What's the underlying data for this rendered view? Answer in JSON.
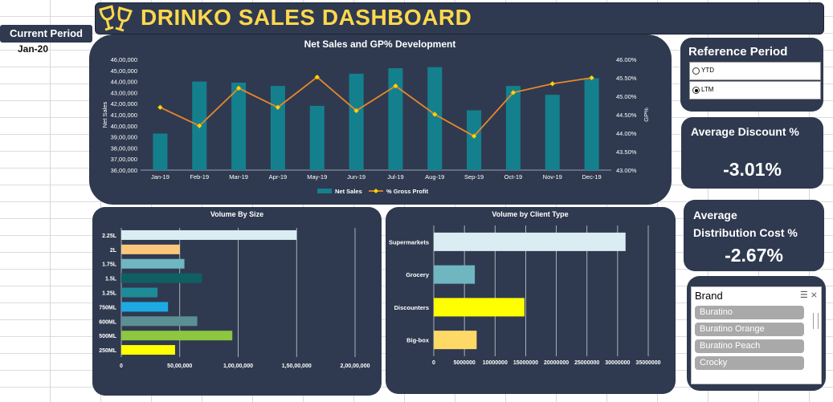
{
  "header": {
    "title": "DRINKO SALES DASHBOARD"
  },
  "current_period": {
    "label": "Current Period",
    "value": "Jan-20"
  },
  "reference_period": {
    "title": "Reference Period",
    "options": [
      {
        "label": "YTD",
        "selected": false
      },
      {
        "label": "LTM",
        "selected": true
      }
    ]
  },
  "kpis": {
    "discount": {
      "title": "Average Discount %",
      "value": "-3.01%"
    },
    "distribution": {
      "title_line1": "Average",
      "title_line2": "Distribution Cost %",
      "value": "-2.67%"
    }
  },
  "brand_slicer": {
    "title": "Brand",
    "items": [
      "Buratino",
      "Buratino Orange",
      "Buratino Peach",
      "Crocky"
    ]
  },
  "colors": {
    "panel": "#2f3a50",
    "bar": "#14808e",
    "line": "#e8872a",
    "marker": "#ffd700",
    "title": "#ffd84d"
  },
  "chart_data": [
    {
      "type": "bar+line",
      "title": "Net Sales and GP% Development",
      "categories": [
        "Jan-19",
        "Feb-19",
        "Mar-19",
        "Apr-19",
        "May-19",
        "Jun-19",
        "Jul-19",
        "Aug-19",
        "Sep-19",
        "Oct-19",
        "Nov-19",
        "Dec-19"
      ],
      "series": [
        {
          "name": "Net Sales",
          "type": "bar",
          "axis": "left",
          "values": [
            39300000,
            44000000,
            43900000,
            43600000,
            41800000,
            44700000,
            45200000,
            45300000,
            41400000,
            43600000,
            42800000,
            44300000
          ]
        },
        {
          "name": "% Gross Profit",
          "type": "line",
          "axis": "right",
          "values": [
            0.447,
            0.442,
            0.4522,
            0.447,
            0.4552,
            0.4461,
            0.4528,
            0.4451,
            0.4392,
            0.451,
            0.4534,
            0.455
          ]
        }
      ],
      "ylabel": "Net Sales",
      "y2label": "GP%",
      "ylim": [
        36000000,
        46000000
      ],
      "y2lim": [
        0.43,
        0.46
      ],
      "yticks": [
        "36,00,000",
        "37,00,000",
        "38,00,000",
        "39,00,000",
        "40,00,000",
        "41,00,000",
        "42,00,000",
        "43,00,000",
        "44,00,000",
        "45,00,000",
        "46,00,000"
      ],
      "y2ticks": [
        "43.00%",
        "43.50%",
        "44.00%",
        "44.50%",
        "45.00%",
        "45.50%",
        "46.00%"
      ],
      "legend": "bottom"
    },
    {
      "type": "bar",
      "orientation": "horizontal",
      "title": "Volume By Size",
      "categories": [
        "2.25L",
        "2L",
        "1.75L",
        "1.5L",
        "1.25L",
        "750ML",
        "600ML",
        "500ML",
        "250ML"
      ],
      "values": [
        15000000,
        5000000,
        5400000,
        6900000,
        3100000,
        4000000,
        6500000,
        9500000,
        4600000
      ],
      "colors": [
        "#d9edf2",
        "#fbc77d",
        "#6fb6c1",
        "#0f5f63",
        "#1f8a98",
        "#1daae4",
        "#5b8f94",
        "#8dc63f",
        "#ffff00"
      ],
      "xlim": [
        0,
        20000000
      ],
      "xticks": [
        "0",
        "50,00,000",
        "1,00,00,000",
        "1,50,00,000",
        "2,00,00,000"
      ]
    },
    {
      "type": "bar",
      "orientation": "horizontal",
      "title": "Volume by Client Type",
      "categories": [
        "Supermarkets",
        "Grocery",
        "Discounters",
        "Big-box"
      ],
      "values": [
        31300000,
        6700000,
        14800000,
        7000000
      ],
      "colors": [
        "#d9edf2",
        "#6fb6c1",
        "#ffff00",
        "#ffd966"
      ],
      "xlim": [
        0,
        35000000
      ],
      "xticks": [
        "0",
        "5000000",
        "10000000",
        "15000000",
        "20000000",
        "25000000",
        "30000000",
        "35000000"
      ]
    }
  ]
}
